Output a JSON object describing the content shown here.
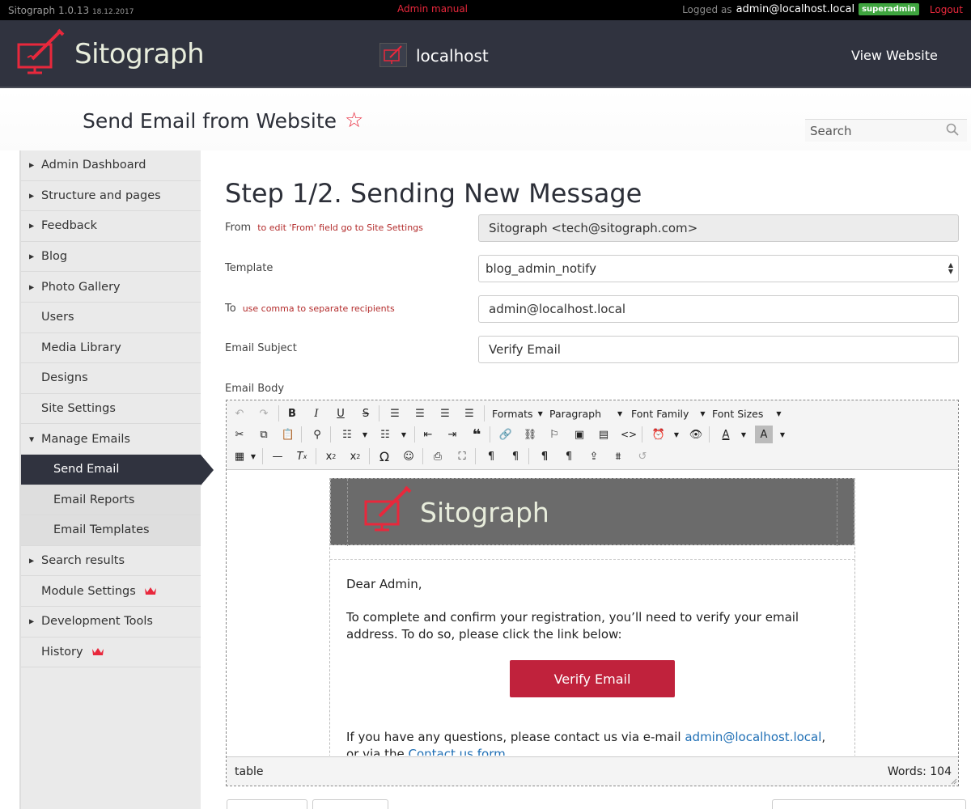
{
  "topbar": {
    "app": "Sitograph 1.0.13",
    "date": "18.12.2017",
    "admin_manual": "Admin manual",
    "logged_as": "Logged as",
    "user": "admin@localhost.local",
    "role": "superadmin",
    "logout": "Logout"
  },
  "header": {
    "brand": "Sitograph",
    "site": "localhost",
    "view_website": "View Website"
  },
  "page": {
    "title": "Send Email from Website",
    "search_placeholder": "Search"
  },
  "sidebar": {
    "items": [
      {
        "label": "Admin Dashboard",
        "arrow": "right"
      },
      {
        "label": "Structure and pages",
        "arrow": "right"
      },
      {
        "label": "Feedback",
        "arrow": "right"
      },
      {
        "label": "Blog",
        "arrow": "right"
      },
      {
        "label": "Photo Gallery",
        "arrow": "right"
      },
      {
        "label": "Users"
      },
      {
        "label": "Media Library"
      },
      {
        "label": "Designs"
      },
      {
        "label": "Site Settings"
      },
      {
        "label": "Manage Emails",
        "arrow": "down"
      },
      {
        "label": "Send Email",
        "sub": true,
        "active": true
      },
      {
        "label": "Email Reports",
        "sub": true
      },
      {
        "label": "Email Templates",
        "sub": true
      },
      {
        "label": "Search results",
        "arrow": "right"
      },
      {
        "label": "Module Settings",
        "crown": true
      },
      {
        "label": "Development Tools",
        "arrow": "right"
      },
      {
        "label": "History",
        "crown": true
      }
    ]
  },
  "form": {
    "step_title": "Step 1/2. Sending New Message",
    "from_label": "From",
    "from_hint_prefix": "to edit 'From' field go to",
    "from_hint_link": "Site Settings",
    "from_value": "Sitograph <tech@sitograph.com>",
    "template_label": "Template",
    "template_value": "blog_admin_notify",
    "to_label": "To",
    "to_hint": "use comma to separate recipients",
    "to_value": "admin@localhost.local",
    "subject_label": "Email Subject",
    "subject_value": "Verify Email",
    "body_label": "Email Body"
  },
  "editor": {
    "formats": "Formats",
    "paragraph": "Paragraph",
    "font_family": "Font Family",
    "font_sizes": "Font Sizes",
    "status_path": "table",
    "words": "Words: 104"
  },
  "email": {
    "brand": "Sitograph",
    "greeting": "Dear Admin,",
    "paragraph": "To complete and confirm your registration, you’ll need to verify your email address. To do so, please click the link below:",
    "button": "Verify Email",
    "contact_prefix": "If you have any questions, please contact us via e-mail",
    "contact_email": "admin@localhost.local",
    "contact_mid": ",",
    "contact_line2_prefix": "or via the",
    "contact_form": "Contact us form"
  },
  "colors": {
    "accent": "#e8283c",
    "header_bg": "#30333f",
    "button": "#c0223c",
    "badge": "#3fa53f"
  }
}
